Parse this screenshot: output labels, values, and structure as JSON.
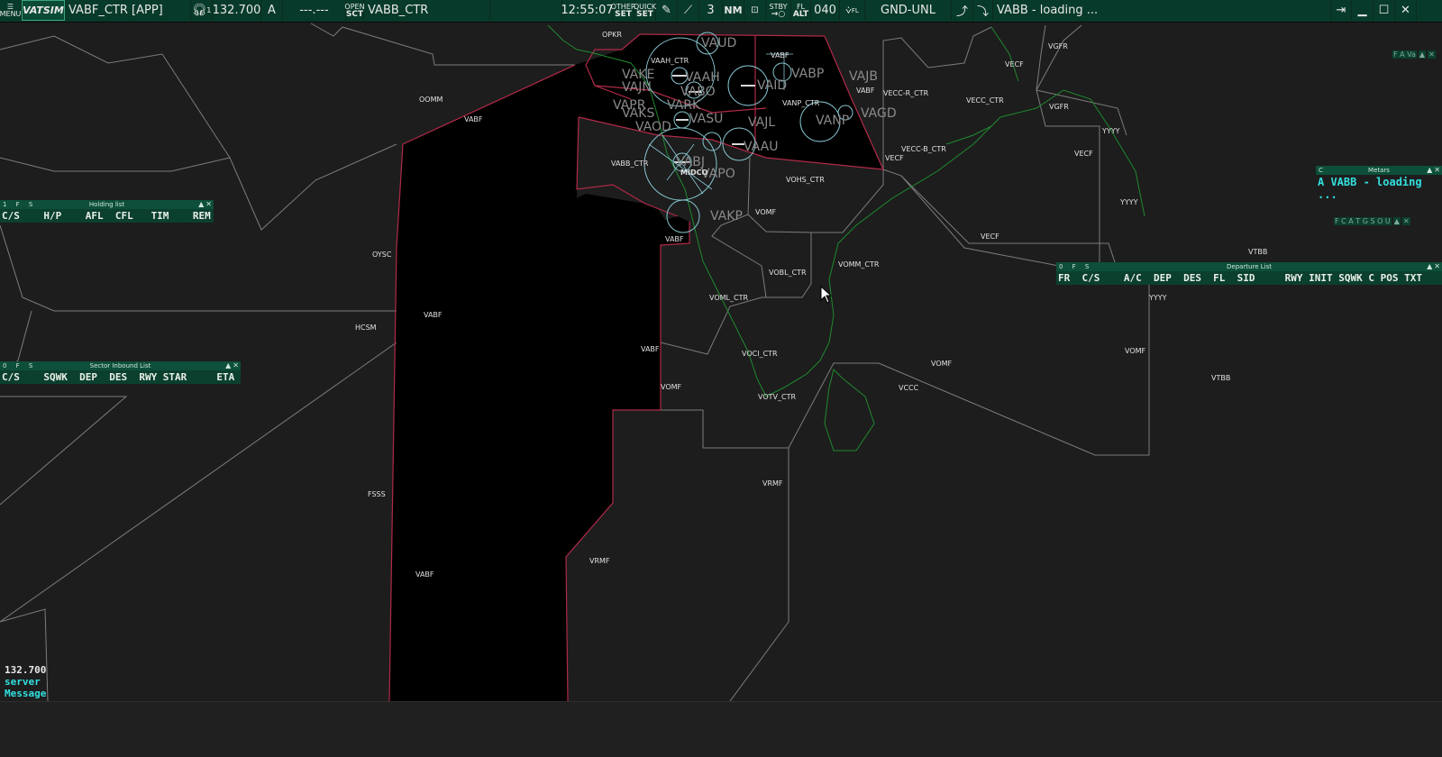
{
  "toolbar": {
    "menu_label": "MENU",
    "logo_label": "VATSIM",
    "callsign": "VABF_CTR [APP]",
    "headset_index": "1",
    "frequency": "132.700",
    "atis_letter": "A",
    "secondary_freq": "---.---",
    "open_label_top": "OPEN",
    "open_label_bottom": "SCT",
    "sector_name": "VABB_CTR",
    "time": "12:55:07",
    "other_top": "OTHER",
    "other_bottom": "SET",
    "quick_top": "QUICK",
    "quick_bottom": "SET",
    "range_value": "3",
    "unit_label": "NM",
    "stby_top": "STBY",
    "fl_top": "FL",
    "fl_bottom": "ALT",
    "altitude_value": "040",
    "fl_small": "FL",
    "filter_label": "GND-UNL",
    "status_text": "VABB - loading ..."
  },
  "holding_list": {
    "title": "Holding list",
    "flags": "1 F S",
    "columns": "C/S    H/P    AFL  CFL   TIM    REM"
  },
  "sector_inbound_list": {
    "title": "Sector Inbound List",
    "flags": "0 F S",
    "columns": "C/S    SQWK  DEP  DES  RWY STAR     ETA"
  },
  "departure_list": {
    "title": "Departure List",
    "flags": "0 F S",
    "columns": "FR  C/S    A/C  DEP  DES  FL  SID     RWY INIT SQWK C POS TXT"
  },
  "metars": {
    "title": "Metars",
    "flag": "C",
    "value": "A VABB - loading ..."
  },
  "mini_windows": {
    "fav_flags": "F A Va",
    "filter_flags": "F C A T G S O U"
  },
  "map_labels": {
    "opkr": "OPKR",
    "vaud": "VAUD",
    "vabf_ne": "VABF",
    "vgfr_n": "VGFR",
    "vecf_n": "VECF",
    "oomm": "OOMM",
    "vabf_w": "VABF",
    "vaah_ctr": "VAAH_CTR",
    "vaah": "VAAH",
    "vabp": "VABP",
    "vajb": "VAJB",
    "vabf_e": "VABF",
    "vecc_r_ctr": "VECC-R_CTR",
    "vecc_ctr": "VECC_CTR",
    "vgfr_e": "VGFR",
    "yyyy_1": "YYYY",
    "vabo": "VABO",
    "vanp_ctr": "VANP_CTR",
    "vaag": "VAGD",
    "vanp": "VANP",
    "vaks": "VAKS",
    "vapr": "VAPR",
    "vajl": "VAJL",
    "vaau": "VAAU",
    "vasu": "VASU",
    "vecc_b_ctr": "VECC-B_CTR",
    "vecf_m": "VECF",
    "vecf_e": "VECF",
    "vabb_ctr": "VABB_CTR",
    "vohs_ctr": "VOHS_CTR",
    "yyyy_2": "YYYY",
    "vakp": "VAKP",
    "vomf_n": "VOMF",
    "vabf_c": "VABF",
    "vecf_s": "VECF",
    "vtbb_n": "VTBB",
    "oysc": "OYSC",
    "vomm_ctr": "VOMM_CTR",
    "vobl_ctr": "VOBL_CTR",
    "voml_ctr": "VOML_CTR",
    "vabf_l": "VABF",
    "hcsm": "HCSM",
    "yyyy_3": "YYYY",
    "vabf_m": "VABF",
    "voci_ctr": "VOCI_CTR",
    "vomf_e": "VOMF",
    "vomf_e2": "VOMF",
    "vtbb_s": "VTBB",
    "vomf_w": "VOMF",
    "vccc": "VCCC",
    "votv_ctr": "VOTV_CTR",
    "vrmf_e": "VRMF",
    "fsss": "FSSS",
    "vabf_s": "VABF",
    "vrmf_w": "VRMF",
    "midco": "MIDCO",
    "vajn": "VAJN",
    "vake": "VAKE",
    "vapo": "VAPO",
    "vaod": "VAOD",
    "vark": "VARK",
    "vabj": "VABJ",
    "vaid": "VAID"
  },
  "bottom": {
    "frequency": "132.700",
    "server": "server",
    "message": "Message"
  },
  "colors": {
    "toolbar_bg": "#073a2a",
    "map_bg": "#1d1d1d",
    "sector_fill": "#000000",
    "boundary_red": "#b02a48",
    "boundary_grey": "#7c7c7c",
    "coastline_green": "#1f8a2f",
    "circle_cyan": "#86c6cf",
    "text_cyan": "#33e0e0"
  }
}
